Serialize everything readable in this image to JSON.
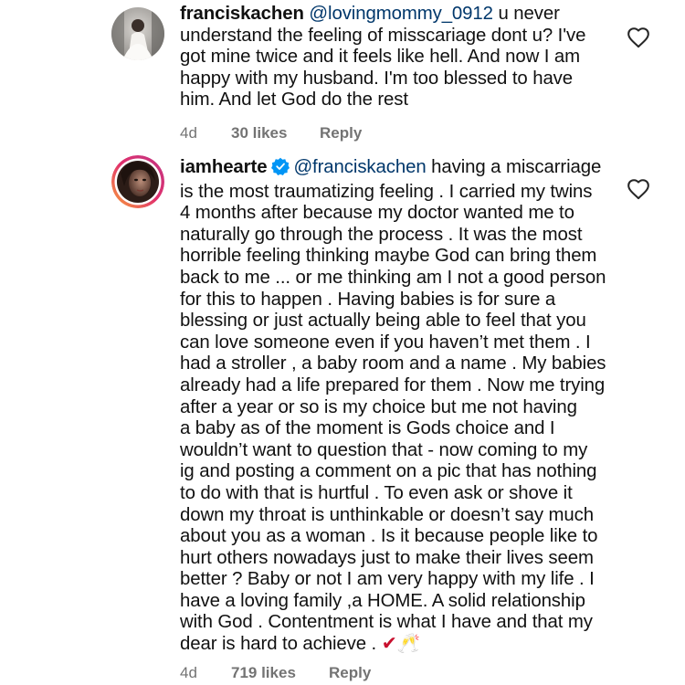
{
  "comments": [
    {
      "username": "franciskachen",
      "mention": "@lovingmommy_0912",
      "lines": [
        " u never",
        "understand the feeling of misscariage dont u? I've",
        "got mine twice and it feels like hell. And now I am",
        "happy with my husband. I'm too blessed to have",
        "him. And let God do the rest"
      ],
      "time": "4d",
      "likes": "30 likes",
      "reply": "Reply",
      "verified": false
    },
    {
      "username": "iamhearte",
      "mention": "@franciskachen",
      "lines": [
        " having a miscarriage",
        "is the most traumatizing feeling . I carried my twins",
        "4 months after because my doctor wanted me to",
        "naturally go through the process . It was the most",
        "horrible feeling thinking maybe God can bring them",
        "back to me ... or me thinking am I not a good person",
        "for this to happen . Having babies is for sure a",
        "blessing or just actually being able to feel that you",
        "can love someone even if you haven’t met them . I",
        "had a stroller , a baby room and a name . My babies",
        "already had a life prepared for them . Now me trying",
        "after a year or so is my choice but me not having",
        "a baby as of the moment is Gods choice  and I",
        "wouldn’t want to question that - now coming to my",
        "ig and posting a comment on a pic that has nothing",
        "to do with that is hurtful . To even ask or shove it",
        "down my throat is unthinkable or doesn’t say much",
        "about you as a woman . Is it because people like to",
        "hurt others nowadays just to make their lives seem",
        "better ? Baby or not I am very happy with my life . I",
        "have a loving family ,a HOME. A solid relationship",
        "with God . Contentment is what I have and that my",
        "dear is hard to achieve . "
      ],
      "emoji": "✔🥂",
      "time": "4d",
      "likes": "719 likes",
      "reply": "Reply",
      "verified": true
    }
  ],
  "icons": {
    "heart": "heart-outline-icon",
    "verified": "verified-badge-icon"
  },
  "colors": {
    "text": "#111111",
    "meta": "#737373",
    "verified": "#0095f6",
    "mention": "#00376b"
  }
}
